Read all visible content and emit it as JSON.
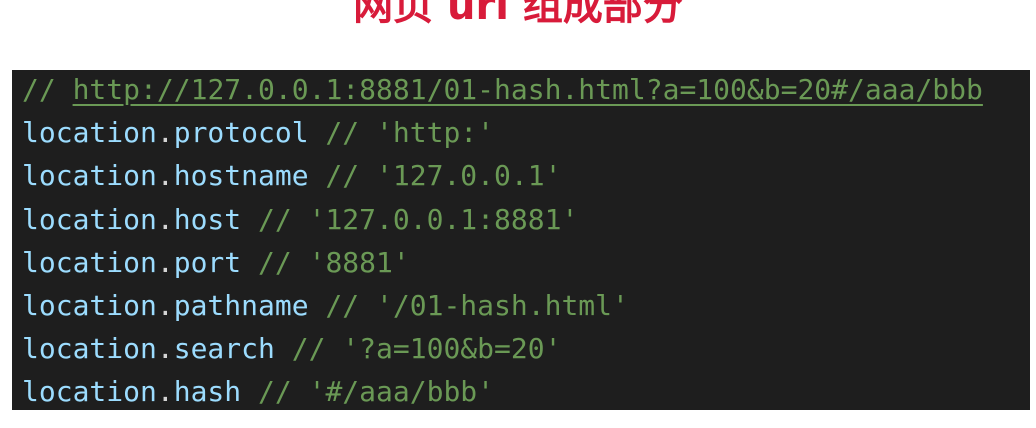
{
  "title": "网页 url 组成部分",
  "code": {
    "header_comment_prefix": "// ",
    "header_url": "http://127.0.0.1:8881/01-hash.html?a=100&b=20#/aaa/bbb",
    "lines": [
      {
        "object": "location",
        "dot": ".",
        "property": "protocol",
        "comment": " // 'http:'"
      },
      {
        "object": "location",
        "dot": ".",
        "property": "hostname",
        "comment": " // '127.0.0.1'"
      },
      {
        "object": "location",
        "dot": ".",
        "property": "host",
        "comment": " // '127.0.0.1:8881'"
      },
      {
        "object": "location",
        "dot": ".",
        "property": "port",
        "comment": " // '8881'"
      },
      {
        "object": "location",
        "dot": ".",
        "property": "pathname",
        "comment": " // '/01-hash.html'"
      },
      {
        "object": "location",
        "dot": ".",
        "property": "search",
        "comment": " // '?a=100&b=20'"
      },
      {
        "object": "location",
        "dot": ".",
        "property": "hash",
        "comment": " // '#/aaa/bbb'"
      }
    ]
  },
  "colors": {
    "title": "#d81b3a",
    "code_background": "#1e1e1e",
    "comment": "#6a9955",
    "identifier": "#9cdcfe",
    "punctuation": "#d4d4d4"
  }
}
